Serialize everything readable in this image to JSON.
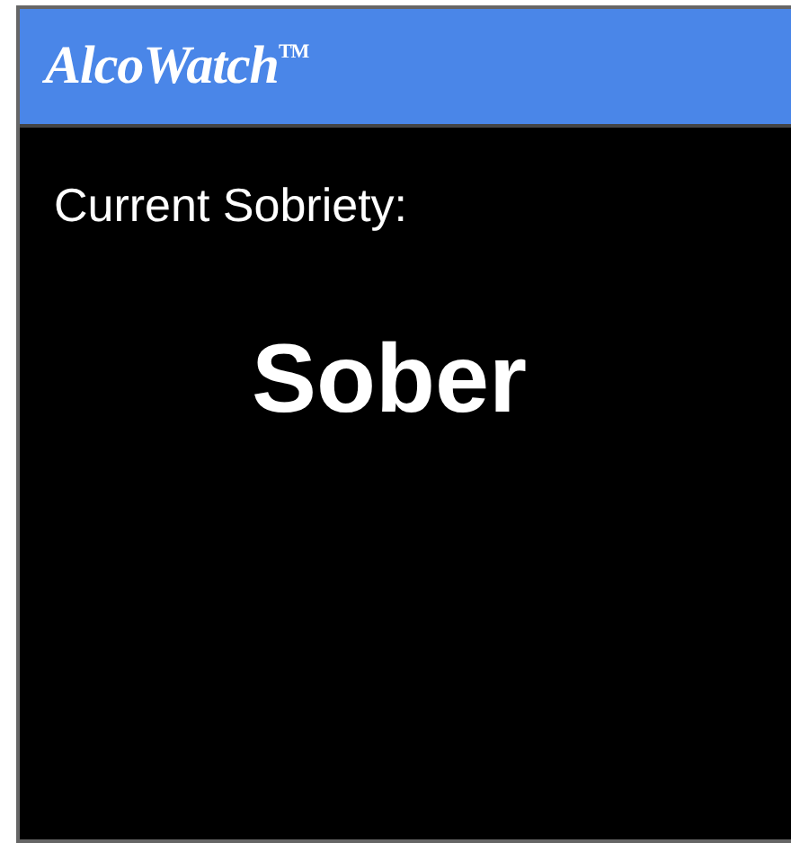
{
  "header": {
    "logo": "AlcoWatch$^{TM}$"
  },
  "status": {
    "label": "Current Sobriety:",
    "value": "Sober"
  }
}
